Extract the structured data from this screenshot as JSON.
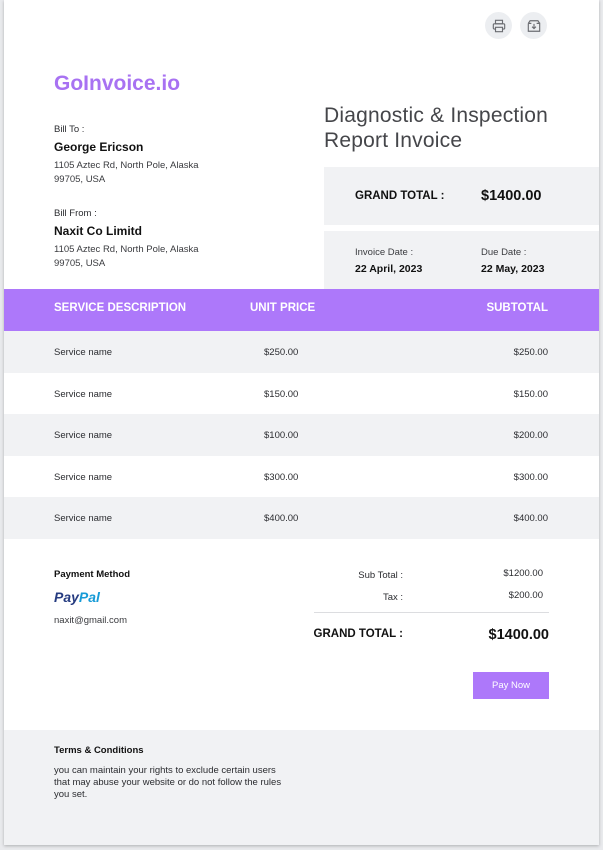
{
  "toolbar": {
    "print_icon": "printer-icon",
    "download_icon": "download-icon"
  },
  "brand": "GoInvoice.io",
  "title": "Diagnostic & Inspection Report Invoice",
  "bill_to": {
    "label": "Bill To :",
    "name": "George Ericson",
    "address": "1105 Aztec Rd, North Pole, Alaska 99705, USA"
  },
  "bill_from": {
    "label": "Bill From :",
    "name": "Naxit Co Limitd",
    "address": "1105 Aztec Rd, North Pole, Alaska 99705, USA"
  },
  "summary_box": {
    "grand_total_label": "GRAND TOTAL :",
    "grand_total_value": "$1400.00"
  },
  "dates": {
    "invoice_label": "Invoice Date :",
    "invoice_value": "22 April, 2023",
    "due_label": "Due Date :",
    "due_value": "22 May, 2023"
  },
  "table": {
    "headers": [
      "SERVICE DESCRIPTION",
      "UNIT PRICE",
      "SUBTOTAL"
    ],
    "rows": [
      {
        "desc": "Service name",
        "price": "$250.00",
        "subtotal": "$250.00"
      },
      {
        "desc": "Service name",
        "price": "$150.00",
        "subtotal": "$150.00"
      },
      {
        "desc": "Service name",
        "price": "$100.00",
        "subtotal": "$200.00"
      },
      {
        "desc": "Service name",
        "price": "$300.00",
        "subtotal": "$300.00"
      },
      {
        "desc": "Service name",
        "price": "$400.00",
        "subtotal": "$400.00"
      }
    ]
  },
  "payment": {
    "label": "Payment Method",
    "logo_text": "PayPal",
    "email": "naxit@gmail.com"
  },
  "totals": {
    "sub_total_label": "Sub Total :",
    "sub_total_value": "$1200.00",
    "tax_label": "Tax :",
    "tax_value": "$200.00",
    "grand_total_label": "GRAND TOTAL :",
    "grand_total_value": "$1400.00"
  },
  "pay_button": "Pay Now",
  "terms": {
    "title": "Terms & Conditions",
    "text": "you can maintain your rights to exclude certain users that may abuse your website or do not follow the rules you set."
  },
  "colors": {
    "accent": "#ad78fa",
    "brand": "#a872f2",
    "panel": "#f1f2f4"
  }
}
